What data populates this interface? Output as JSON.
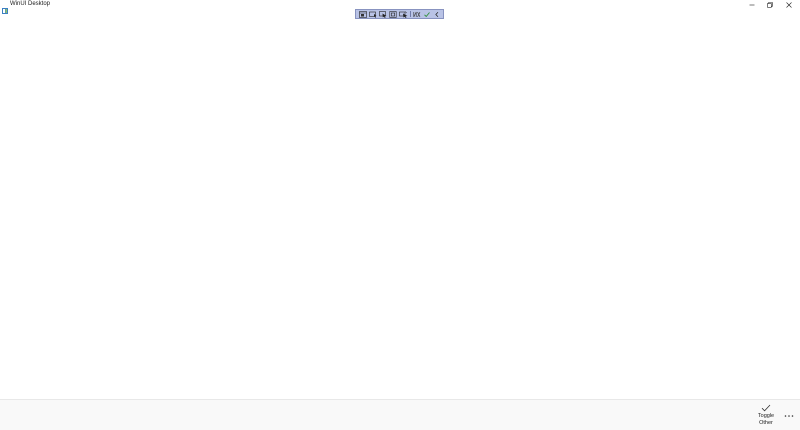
{
  "window": {
    "title": "WinUI Desktop"
  },
  "caption": {
    "minimize_icon": "minimize-icon",
    "maximize_icon": "restore-icon",
    "close_icon": "close-icon"
  },
  "debug_toolbar": {
    "background": "#b9c3e6",
    "items": [
      {
        "icon": "live-visual-tree-icon"
      },
      {
        "icon": "select-element-icon"
      },
      {
        "icon": "display-layout-adorners-icon"
      },
      {
        "icon": "track-focused-element-icon"
      },
      {
        "icon": "show-binding-failures-icon"
      },
      {
        "icon": "hot-reload-icon"
      },
      {
        "icon": "accessibility-check-icon"
      },
      {
        "icon": "collapse-toolbar-icon"
      }
    ]
  },
  "commandbar": {
    "toggle_label": "Toggle Other",
    "toggle_label_line1": "Toggle",
    "toggle_label_line2": "Other",
    "toggle_icon": "checkmark-icon",
    "more_icon": "more-ellipsis-icon"
  }
}
